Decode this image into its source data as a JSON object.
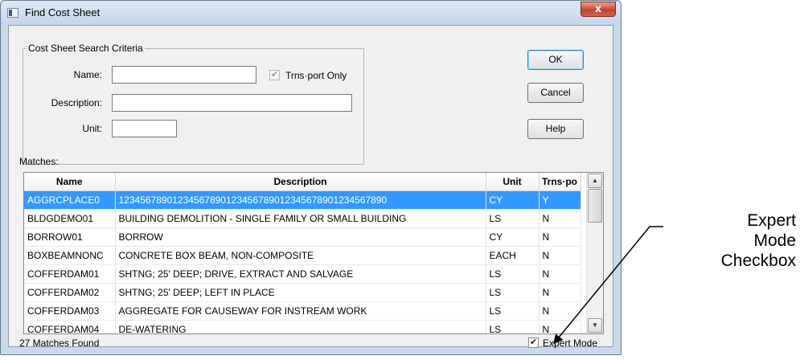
{
  "window": {
    "title": "Find Cost Sheet",
    "close_glyph": "x"
  },
  "criteria": {
    "legend": "Cost Sheet Search Criteria",
    "name_label": "Name:",
    "name_value": "",
    "trnsport_only_label": "Trns·port Only",
    "trnsport_only_checked": true,
    "description_label": "Description:",
    "description_value": "",
    "unit_label": "Unit:",
    "unit_value": ""
  },
  "buttons": {
    "ok": "OK",
    "cancel": "Cancel",
    "help": "Help"
  },
  "matches": {
    "label": "Matches:",
    "columns": [
      "Name",
      "Description",
      "Unit",
      "Trns·po"
    ],
    "rows": [
      {
        "name": "AGGRCPLACE0",
        "description": "12345678901234567890123456789012345678901234567890",
        "unit": "CY",
        "trnsport": "Y",
        "selected": true
      },
      {
        "name": "BLDGDEMO01",
        "description": "BUILDING DEMOLITION - SINGLE FAMILY OR SMALL BUILDING",
        "unit": "LS",
        "trnsport": "N"
      },
      {
        "name": "BORROW01",
        "description": "BORROW",
        "unit": "CY",
        "trnsport": "N"
      },
      {
        "name": "BOXBEAMNONC",
        "description": "CONCRETE BOX BEAM, NON-COMPOSITE",
        "unit": "EACH",
        "trnsport": "N"
      },
      {
        "name": "COFFERDAM01",
        "description": "SHTNG; 25' DEEP; DRIVE, EXTRACT AND SALVAGE",
        "unit": "LS",
        "trnsport": "N"
      },
      {
        "name": "COFFERDAM02",
        "description": "SHTNG; 25' DEEP; LEFT IN PLACE",
        "unit": "LS",
        "trnsport": "N"
      },
      {
        "name": "COFFERDAM03",
        "description": "AGGREGATE FOR CAUSEWAY FOR INSTREAM WORK",
        "unit": "LS",
        "trnsport": "N"
      },
      {
        "name": "COFFERDAM04",
        "description": "DE-WATERING",
        "unit": "LS",
        "trnsport": "N"
      }
    ]
  },
  "status": {
    "count_text": "27 Matches Found",
    "expert_mode_label": "Expert Mode",
    "expert_mode_checked": true
  },
  "annotation": {
    "lines": [
      "Expert",
      "Mode",
      "Checkbox"
    ]
  },
  "icons": {
    "app": "window-icon",
    "close": "close-icon",
    "checkbox": "check-icon",
    "scroll_up": "arrow-up-icon",
    "scroll_down": "arrow-down-icon"
  }
}
